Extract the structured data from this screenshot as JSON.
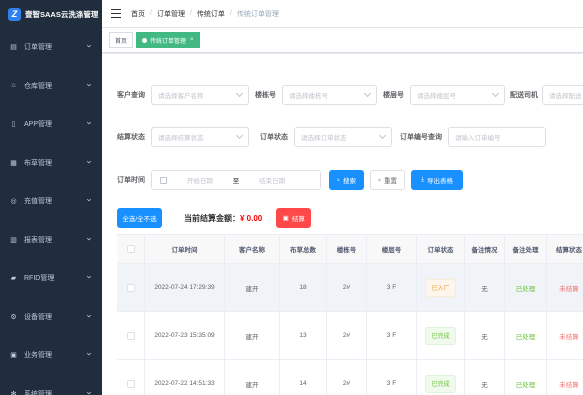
{
  "app": {
    "title": "壹智SAAS云洗涤管理",
    "logo_letter": "Z"
  },
  "sidebar": {
    "items": [
      {
        "label": "订单管理",
        "icon": "clipboard-icon"
      },
      {
        "label": "仓库管理",
        "icon": "home-icon"
      },
      {
        "label": "APP管理",
        "icon": "phone-icon"
      },
      {
        "label": "布草管理",
        "icon": "grid-icon"
      },
      {
        "label": "充值管理",
        "icon": "coin-icon"
      },
      {
        "label": "报表管理",
        "icon": "report-icon"
      },
      {
        "label": "RFID管理",
        "icon": "database-icon"
      },
      {
        "label": "设备管理",
        "icon": "device-icon"
      },
      {
        "label": "业务管理",
        "icon": "briefcase-icon"
      },
      {
        "label": "系统管理",
        "icon": "gear-icon"
      }
    ]
  },
  "breadcrumb": [
    "首页",
    "订单管理",
    "传统订单",
    "传统订单管理"
  ],
  "tags": {
    "home": "首页",
    "current": "传统订单管理",
    "close": "×"
  },
  "filters": {
    "customer_label": "客户查询",
    "customer_placeholder": "请选择客户名称",
    "building_label": "楼栋号",
    "building_placeholder": "请选择楼栋号",
    "floor_label": "楼层号",
    "floor_placeholder": "请选择楼层号",
    "driver_label": "配送司机",
    "driver_placeholder": "请选择配送",
    "settle_label": "结算状态",
    "settle_placeholder": "请选择结算状态",
    "order_status_label": "订单状态",
    "order_status_placeholder": "请选择订单状态",
    "order_no_label": "订单编号查询",
    "order_no_placeholder": "请输入订单编号",
    "time_label": "订单时间",
    "start_placeholder": "开始日期",
    "range_sep": "至",
    "end_placeholder": "结束日期",
    "search_btn": "搜索",
    "reset_btn": "重置",
    "export_btn": "导出表格"
  },
  "actions": {
    "select_all": "全选/全不选",
    "total_label": "当前结算金额：",
    "total_value": "¥ 0.00",
    "settle_btn": "结算"
  },
  "table": {
    "columns": [
      "",
      "订单时间",
      "客户名称",
      "布草总数",
      "楼栋号",
      "楼层号",
      "订单状态",
      "备注情况",
      "备注处理",
      "结算状态"
    ],
    "rows": [
      {
        "time": "2022-07-24 17:29:39",
        "customer": "建开",
        "total": "18",
        "building": "2#",
        "floor": "3 F",
        "status": "已入厂",
        "status_color": "orange",
        "remark": "无",
        "handle": "已处理",
        "settle": "未结算"
      },
      {
        "time": "2022-07-23 15:35:09",
        "customer": "建开",
        "total": "13",
        "building": "2#",
        "floor": "3 F",
        "status": "已完成",
        "status_color": "green",
        "remark": "无",
        "handle": "已处理",
        "settle": "未结算"
      },
      {
        "time": "2022-07-22 14:51:33",
        "customer": "建开",
        "total": "14",
        "building": "2#",
        "floor": "3 F",
        "status": "已完成",
        "status_color": "green",
        "remark": "无",
        "handle": "已处理",
        "settle": "未结算"
      }
    ]
  },
  "colors": {
    "sidebar_bg": "#1f2d3d",
    "primary": "#1890ff",
    "tag_active": "#42b983",
    "danger": "#ff4949"
  }
}
